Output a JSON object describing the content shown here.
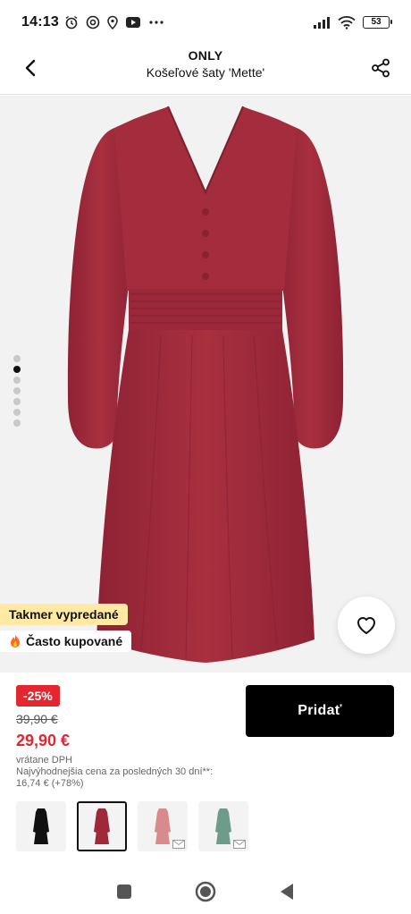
{
  "status_bar": {
    "time": "14:13",
    "battery": "53",
    "icons": [
      "alarm-icon",
      "chrome-icon",
      "location-icon",
      "youtube-icon",
      "more-icon",
      "signal-icon",
      "wifi-icon"
    ]
  },
  "header": {
    "brand": "ONLY",
    "product_name": "Košeľové šaty 'Mette'",
    "back_icon": "chevron-left-icon",
    "share_icon": "share-icon"
  },
  "gallery": {
    "image_count": 7,
    "active_index": 1,
    "badge_sold_out": "Takmer vypredané",
    "badge_popular": "Často kupované",
    "popular_icon": "fire-icon",
    "wishlist_icon": "heart-icon",
    "dress_color": "#a0283b"
  },
  "pricing": {
    "discount": "-25%",
    "old_price": "39,90 €",
    "new_price": "29,90 €",
    "vat_note": "vrátane DPH",
    "lowest_price_line1": "Najvýhodnejšia cena za posledných 30 dní**:",
    "lowest_price_line2": "16,74 € (+78%)",
    "accent": "#e3262f"
  },
  "actions": {
    "add_label": "Pridať"
  },
  "variants": [
    {
      "color": "#111111",
      "selected": false,
      "notify": false
    },
    {
      "color": "#a0283b",
      "selected": true,
      "notify": false
    },
    {
      "color": "#d98b8b",
      "selected": false,
      "notify": true
    },
    {
      "color": "#6e9c8a",
      "selected": false,
      "notify": true
    }
  ],
  "nav": {
    "icons": [
      "recents-icon",
      "home-icon",
      "back-icon"
    ]
  }
}
